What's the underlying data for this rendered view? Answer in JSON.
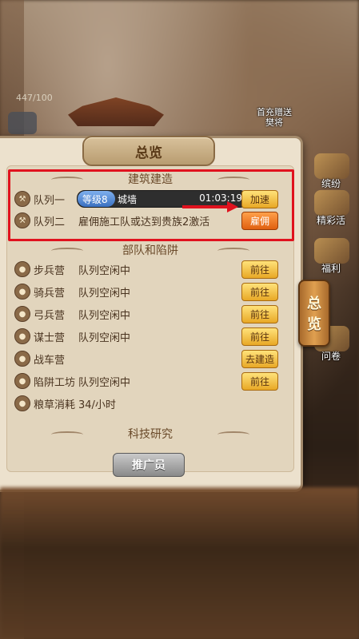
{
  "hud": {
    "resource_count": "447/100",
    "promo_label": "首充赠送\n樊将"
  },
  "side_menu": {
    "items": [
      {
        "label": "缤纷"
      },
      {
        "label": "精彩活"
      },
      {
        "label": "福利"
      },
      {
        "label": "问卷"
      }
    ],
    "active_tab": "总览"
  },
  "panel": {
    "title": "总览",
    "construction": {
      "header": "建筑建造",
      "queue1": {
        "label": "队列一",
        "level": "等级8",
        "building": "城墙",
        "time": "01:03:19",
        "progress": 0.22,
        "button": "加速"
      },
      "queue2": {
        "label": "队列二",
        "status": "雇佣施工队或达到贵族2激活",
        "button": "雇佣"
      }
    },
    "troops": {
      "header": "部队和陷阱",
      "rows": [
        {
          "name": "步兵营",
          "status": "队列空闲中",
          "button": "前往"
        },
        {
          "name": "骑兵营",
          "status": "队列空闲中",
          "button": "前往"
        },
        {
          "name": "弓兵营",
          "status": "队列空闲中",
          "button": "前往"
        },
        {
          "name": "谋士营",
          "status": "队列空闲中",
          "button": "前往"
        },
        {
          "name": "战车营",
          "status": "",
          "button": "去建造"
        },
        {
          "name": "陷阱工坊",
          "status": "队列空闲中",
          "button": "前往"
        },
        {
          "name": "粮草消耗",
          "status": "34/小时",
          "button": ""
        }
      ]
    },
    "tech_header": "科技研究",
    "promoter_button": "推广员"
  },
  "colors": {
    "highlight": "#e0121e",
    "button_yellow": "#f0b830",
    "button_orange": "#f07020",
    "progress_blue": "#4a80d0"
  }
}
